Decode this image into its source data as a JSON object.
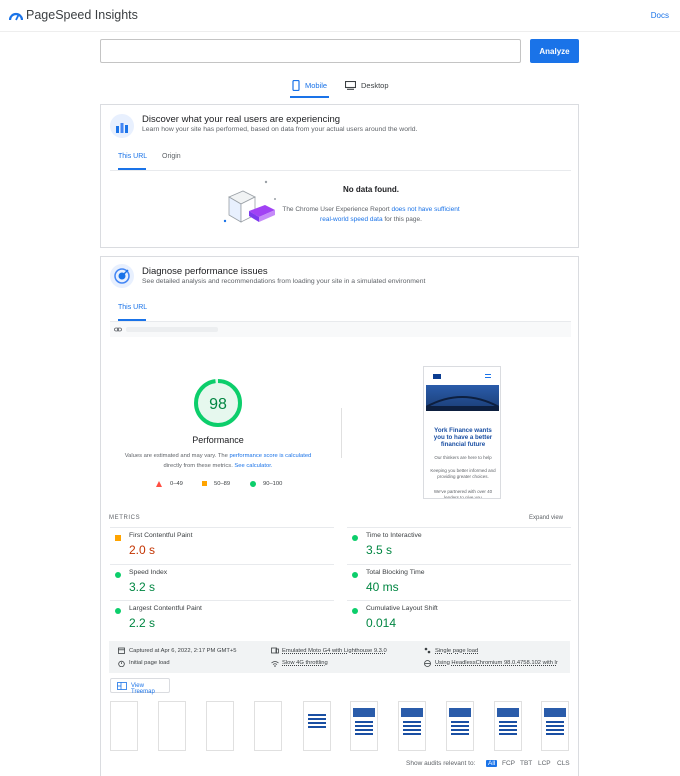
{
  "header": {
    "brand": "PageSpeed Insights",
    "docs": "Docs"
  },
  "search": {
    "value": "",
    "analyze": "Analyze"
  },
  "device_tabs": [
    {
      "label": "Mobile",
      "active": true
    },
    {
      "label": "Desktop",
      "active": false
    }
  ],
  "field": {
    "title": "Discover what your real users are experiencing",
    "subtitle": "Learn how your site has performed, based on data from your actual users around the world.",
    "tabs": [
      "This URL",
      "Origin"
    ],
    "no_data": "No data found.",
    "msg_before": "The Chrome User Experience Report ",
    "msg_link": "does not have sufficient real-world speed data",
    "msg_after": " for this page."
  },
  "lab": {
    "title": "Diagnose performance issues",
    "subtitle": "See detailed analysis and recommendations from loading your site in a simulated environment",
    "tab": "This URL",
    "score": "98",
    "score_fraction": 0.98,
    "score_label": "Performance",
    "note_before": "Values are estimated and may vary. The ",
    "note_link": "performance score is calculated",
    "note_mid": " directly from these metrics. ",
    "note_link2": "See calculator.",
    "legend": [
      "0–49",
      "50–89",
      "90–100"
    ]
  },
  "preview": {
    "headline": "York Finance wants you to have a better financial future",
    "body1": "Our thinkers are here to help",
    "body2": "Keeping you better informed and providing greater choices.",
    "body3": "We've partnered with over 40 lenders to give you"
  },
  "metrics": {
    "heading": "METRICS",
    "expand": "Expand view",
    "items": [
      {
        "label": "First Contentful Paint",
        "value": "2.0 s",
        "status": "average"
      },
      {
        "label": "Time to Interactive",
        "value": "3.5 s",
        "status": "good"
      },
      {
        "label": "Speed Index",
        "value": "3.2 s",
        "status": "good"
      },
      {
        "label": "Total Blocking Time",
        "value": "40 ms",
        "status": "good"
      },
      {
        "label": "Largest Contentful Paint",
        "value": "2.2 s",
        "status": "good"
      },
      {
        "label": "Cumulative Layout Shift",
        "value": "0.014",
        "status": "good"
      }
    ]
  },
  "runtime": {
    "captured": "Captured at Apr 6, 2022, 2:17 PM GMT+5",
    "initial": "Initial page load",
    "device": "Emulated Moto G4 with Lighthouse 9.3.0",
    "throttle": "Slow 4G throttling",
    "single": "Single page load",
    "browser": "Using HeadlessChromium 98.0.4758.102 with lr"
  },
  "treemap": "View Treemap",
  "audits": {
    "label": "Show audits relevant to:",
    "items": [
      "All",
      "FCP",
      "TBT",
      "LCP",
      "CLS"
    ]
  },
  "colors": {
    "accent": "#1a73e8",
    "good": "#0cce6b",
    "average": "#ffa400",
    "poor": "#ff4e42",
    "good_text": "#018642",
    "avg_text": "#c33300"
  }
}
